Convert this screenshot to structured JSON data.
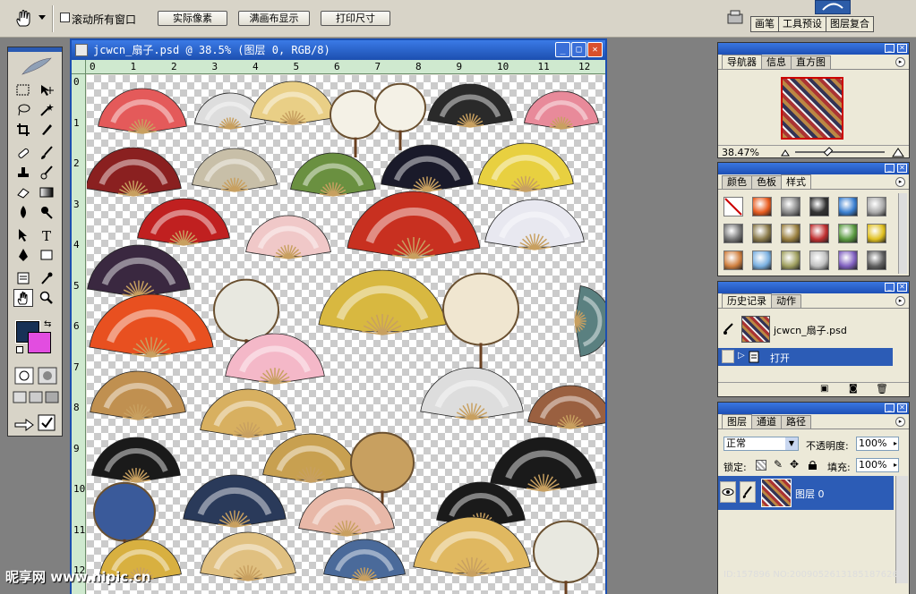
{
  "options_bar": {
    "scroll_all_label": "滚动所有窗口",
    "actual_pixels": "实际像素",
    "fit_screen": "满画布显示",
    "print_size": "打印尺寸"
  },
  "top_tabs": [
    "画笔",
    "工具预设",
    "图层复合"
  ],
  "document": {
    "title": "jcwcn_扇子.psd @ 38.5% (图层 0, RGB/8)",
    "ruler_h": [
      "0",
      "1",
      "2",
      "3",
      "4",
      "5",
      "6",
      "7",
      "8",
      "9",
      "10",
      "11",
      "12"
    ],
    "ruler_v": [
      "0",
      "1",
      "2",
      "3",
      "4",
      "5",
      "6",
      "7",
      "8",
      "9",
      "10",
      "11",
      "12"
    ]
  },
  "colors": {
    "foreground": "#173156",
    "background": "#e24de0",
    "accent": "#1d4fb6"
  },
  "navigator": {
    "tabs": [
      "导航器",
      "信息",
      "直方图"
    ],
    "zoom": "38.47%"
  },
  "styles_panel": {
    "tabs": [
      "颜色",
      "色板",
      "样式"
    ]
  },
  "history": {
    "tabs": [
      "历史记录",
      "动作"
    ],
    "snapshot": "jcwcn_扇子.psd",
    "step": "打开"
  },
  "layers": {
    "tabs": [
      "图层",
      "通道",
      "路径"
    ],
    "blend_mode": "正常",
    "opacity_label": "不透明度:",
    "opacity": "100%",
    "lock_label": "锁定:",
    "fill_label": "填充:",
    "fill": "100%",
    "layer_name": "图层 0"
  },
  "watermark": {
    "brand": "昵享网 www.nipic.cn",
    "id": "ID:157896 NO:20090526131851876267"
  }
}
